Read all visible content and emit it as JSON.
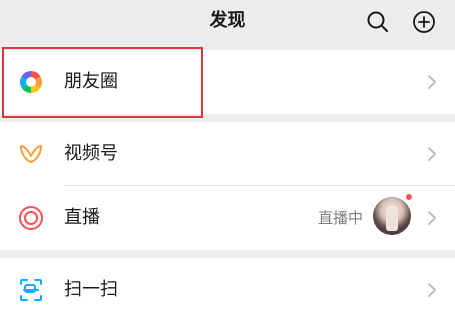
{
  "header": {
    "title": "发现",
    "search_icon": "search-icon",
    "add_icon": "add-circle-icon"
  },
  "items": [
    {
      "label": "朋友圈",
      "icon": "moments-aperture-icon"
    },
    {
      "label": "视频号",
      "icon": "channels-butterfly-icon"
    },
    {
      "label": "直播",
      "icon": "live-concentric-circles-icon",
      "status": "直播中"
    },
    {
      "label": "扫一扫",
      "icon": "scan-icon"
    }
  ],
  "colors": {
    "background": "#ededed",
    "row": "#ffffff",
    "text": "#191919",
    "secondary_text": "#7f7f7f",
    "channels_accent": "#fa9d3b",
    "live_accent": "#fa5151",
    "scan_accent": "#10aeff",
    "highlight_border": "#d9363e"
  }
}
